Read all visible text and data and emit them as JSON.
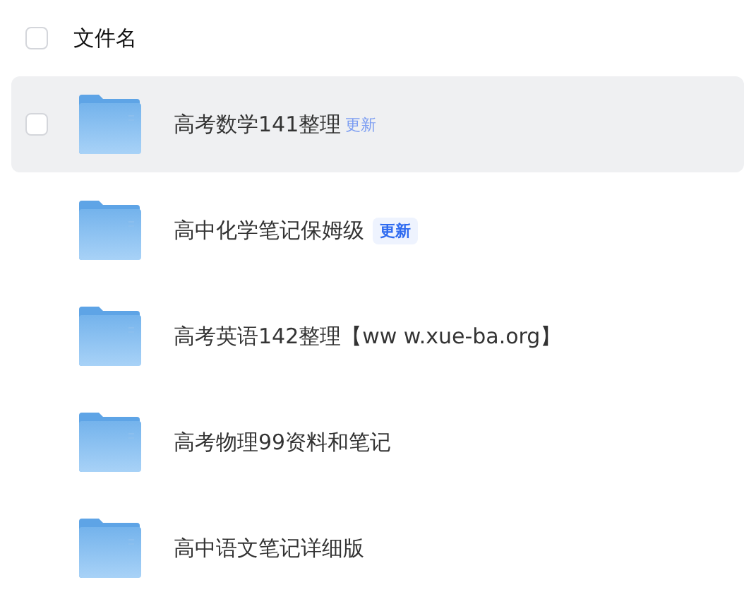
{
  "header": {
    "checkbox_checked": false,
    "label": "文件名"
  },
  "files": [
    {
      "name": "高考数学141整理",
      "badge": "更新",
      "hovered": true,
      "checked": false
    },
    {
      "name": "高中化学笔记保姆级",
      "badge": "更新",
      "hovered": false,
      "checked": false
    },
    {
      "name": "高考英语142整理【ww w.xue-ba.org】",
      "hovered": false,
      "checked": false
    },
    {
      "name": "高考物理99资料和笔记",
      "hovered": false,
      "checked": false
    },
    {
      "name": "高中语文笔记详细版",
      "hovered": false,
      "checked": false
    }
  ]
}
